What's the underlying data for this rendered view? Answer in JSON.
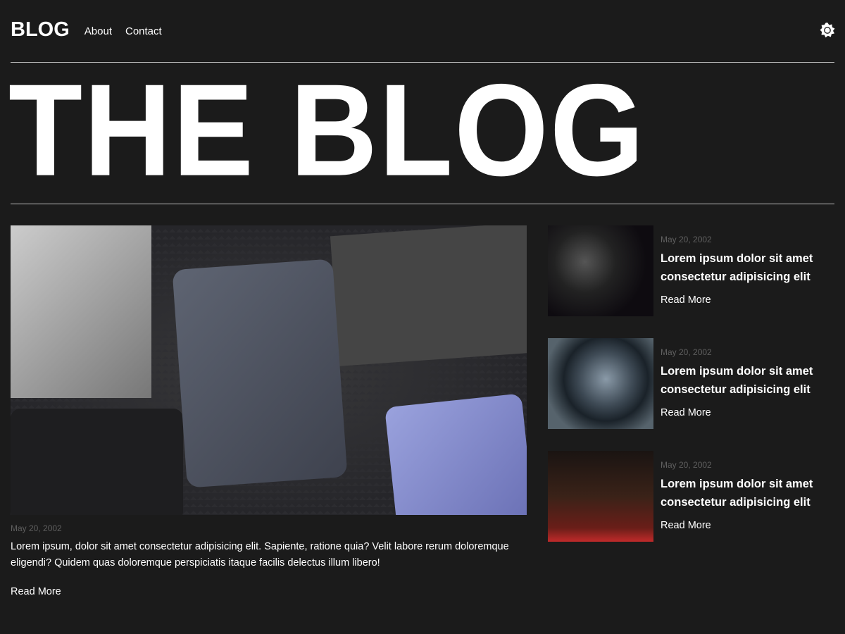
{
  "nav": {
    "logo": "BLOG",
    "links": [
      "About",
      "Contact"
    ],
    "theme_icon": "sun-icon"
  },
  "hero_title": "THE BLOG",
  "featured": {
    "date": "May 20, 2002",
    "excerpt": "Lorem ipsum, dolor sit amet consectetur adipisicing elit. Sapiente, ratione quia? Velit labore rerum doloremque eligendi? Quidem quas doloremque perspiciatis itaque facilis delectus illum libero!",
    "read_more": "Read More"
  },
  "posts": [
    {
      "date": "May 20, 2002",
      "title": "Lorem ipsum dolor sit amet consectetur adipisicing elit",
      "read_more": "Read More"
    },
    {
      "date": "May 20, 2002",
      "title": "Lorem ipsum dolor sit amet consectetur adipisicing elit",
      "read_more": "Read More"
    },
    {
      "date": "May 20, 2002",
      "title": "Lorem ipsum dolor sit amet consectetur adipisicing elit",
      "read_more": "Read More"
    }
  ]
}
